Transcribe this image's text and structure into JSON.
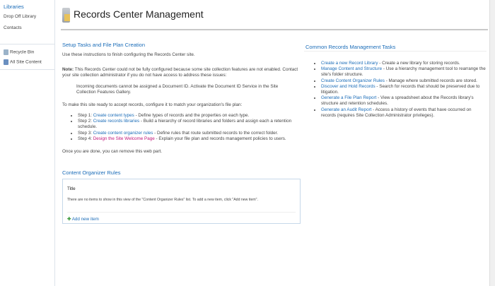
{
  "nav": {
    "heading": "Libraries",
    "items": [
      "Drop Off Library",
      "Contacts"
    ],
    "recycle": "Recycle Bin",
    "all_content": "All Site Content"
  },
  "page_title": "Records Center Management",
  "setup": {
    "heading": "Setup Tasks and File Plan Creation",
    "intro": "Use these instructions to finish configuring the Records Center site.",
    "note_label": "Note:",
    "note": " This Records Center could not be fully configured because some site collection features are not enabled. Contact your site collection administrator if you do not have access to address these issues:",
    "issue": "Incoming documents cannot be assigned a Document ID. Activate the Document ID Service in the Site Collection Features Gallery.",
    "make_ready": "To make this site ready to accept records, configure it to match your organization's file plan:",
    "steps": [
      {
        "prefix": "Step 1: ",
        "link": "Create content types",
        "text": " - Define types of records and the properties on each type."
      },
      {
        "prefix": "Step 2: ",
        "link": "Create records libraries",
        "text": " - Build a hierarchy of record libraries and folders and assign each a retention schedule."
      },
      {
        "prefix": "Step 3: ",
        "link": "Create content organizer rules",
        "text": " - Define rules that route submitted records to the correct folder."
      },
      {
        "prefix": "Step 4: ",
        "link": "Design the Site Welcome Page",
        "text": " - Explain your file plan and records management policies to users."
      }
    ],
    "done": "Once you are done, you can remove this web part."
  },
  "rules": {
    "heading": "Content Organizer Rules",
    "column": "Title",
    "empty": "There are no items to show in this view of the \"Content Organizer Rules\" list. To add a new item, click \"Add new item\".",
    "add": "Add new item"
  },
  "common": {
    "heading": "Common Records Management Tasks",
    "tasks": [
      {
        "link": "Create a new Record Library",
        "text": " - Create a new library for storing records."
      },
      {
        "link": "Manage Content and Structure",
        "text": " - Use a hierarchy management tool to rearrange the site's folder structure."
      },
      {
        "link": "Create Content Organizer Rules",
        "text": " - Manage where submitted records are stored."
      },
      {
        "link": "Discover and Hold Records",
        "text": " - Search for records that should be preserved due to litigation."
      },
      {
        "link": "Generate a File Plan Report",
        "text": " - View a spreadsheet about the Records library's structure and retention schedules."
      },
      {
        "link": "Generate an Audit Report",
        "text": " - Access a history of events that have occurred on records (requires Site Collection Administrator privileges)."
      }
    ]
  }
}
